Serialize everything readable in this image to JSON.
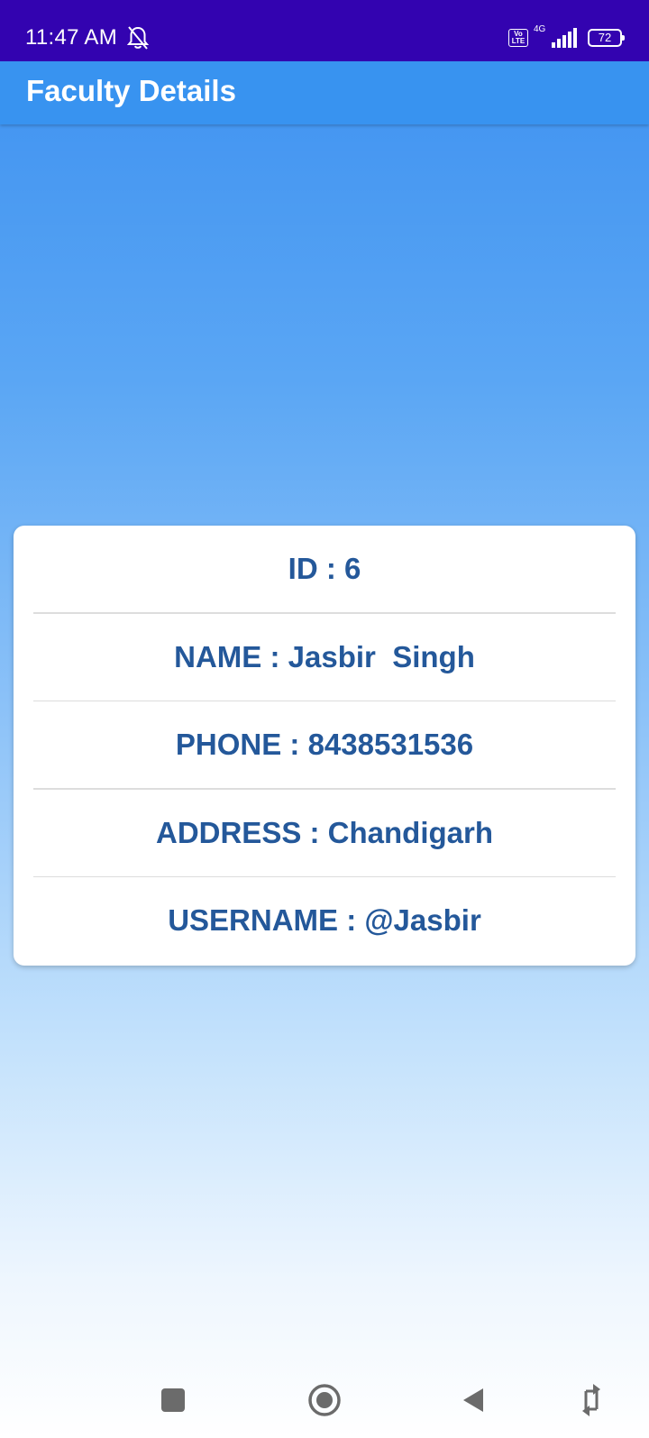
{
  "status_bar": {
    "time": "11:47 AM",
    "network": "4G",
    "volte": "Vo LTE",
    "battery": "72",
    "icons": [
      "bell-muted-icon",
      "volte-icon",
      "signal-icon",
      "battery-icon"
    ]
  },
  "app_bar": {
    "title": "Faculty Details",
    "color": "#3893f0"
  },
  "details": {
    "id": "ID : 6",
    "name": "NAME : Jasbir  Singh",
    "phone": "PHONE : 8438531536",
    "address": "ADDRESS : Chandigarh",
    "username": "USERNAME : @Jasbir"
  },
  "colors": {
    "status_bar": "#3303b0",
    "text_accent": "#24589a"
  },
  "nav_bar": {
    "icons": [
      "recents-square-icon",
      "home-circle-icon",
      "back-triangle-icon",
      "rotate-icon"
    ]
  }
}
